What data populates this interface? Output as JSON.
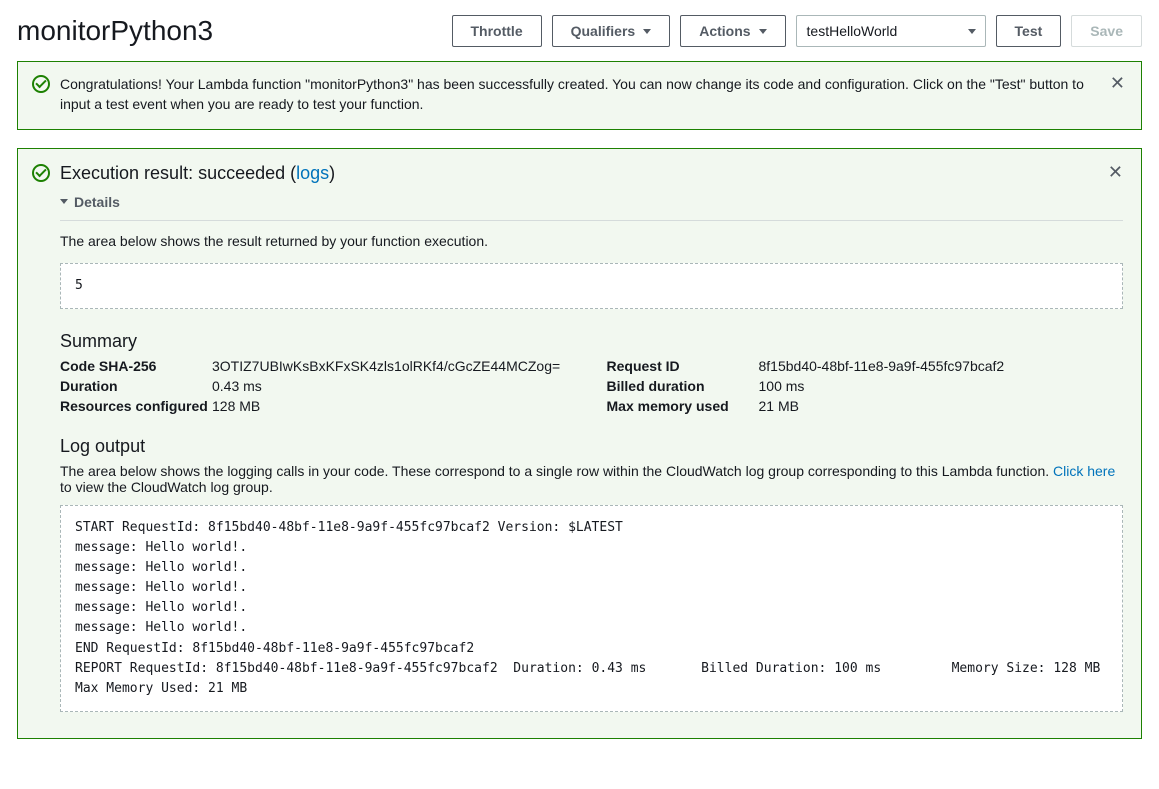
{
  "header": {
    "title": "monitorPython3",
    "throttle": "Throttle",
    "qualifiers": "Qualifiers",
    "actions": "Actions",
    "test_event_selected": "testHelloWorld",
    "test": "Test",
    "save": "Save"
  },
  "banner": {
    "message": "Congratulations! Your Lambda function \"monitorPython3\" has been successfully created. You can now change its code and configuration. Click on the \"Test\" button to input a test event when you are ready to test your function."
  },
  "result": {
    "title_prefix": "Execution result: succeeded (",
    "logs_label": "logs",
    "title_suffix": ")",
    "details_label": "Details",
    "return_description": "The area below shows the result returned by your function execution.",
    "return_value": "5",
    "summary_title": "Summary",
    "summary_left": {
      "code_sha_label": "Code SHA-256",
      "code_sha_value": "3OTIZ7UBIwKsBxKFxSK4zls1olRKf4/cGcZE44MCZog=",
      "duration_label": "Duration",
      "duration_value": "0.43 ms",
      "resources_label": "Resources configured",
      "resources_value": "128 MB"
    },
    "summary_right": {
      "request_id_label": "Request ID",
      "request_id_value": "8f15bd40-48bf-11e8-9a9f-455fc97bcaf2",
      "billed_label": "Billed duration",
      "billed_value": "100 ms",
      "max_mem_label": "Max memory used",
      "max_mem_value": "21 MB"
    },
    "log_title": "Log output",
    "log_description_prefix": "The area below shows the logging calls in your code. These correspond to a single row within the CloudWatch log group corresponding to this Lambda function. ",
    "log_link_text": "Click here",
    "log_description_suffix": " to view the CloudWatch log group.",
    "log_output": "START RequestId: 8f15bd40-48bf-11e8-9a9f-455fc97bcaf2 Version: $LATEST\nmessage: Hello world!.\nmessage: Hello world!.\nmessage: Hello world!.\nmessage: Hello world!.\nmessage: Hello world!.\nEND RequestId: 8f15bd40-48bf-11e8-9a9f-455fc97bcaf2\nREPORT RequestId: 8f15bd40-48bf-11e8-9a9f-455fc97bcaf2\tDuration: 0.43 ms\tBilled Duration: 100 ms \tMemory Size: 128 MB\tMax Memory Used: 21 MB"
  }
}
